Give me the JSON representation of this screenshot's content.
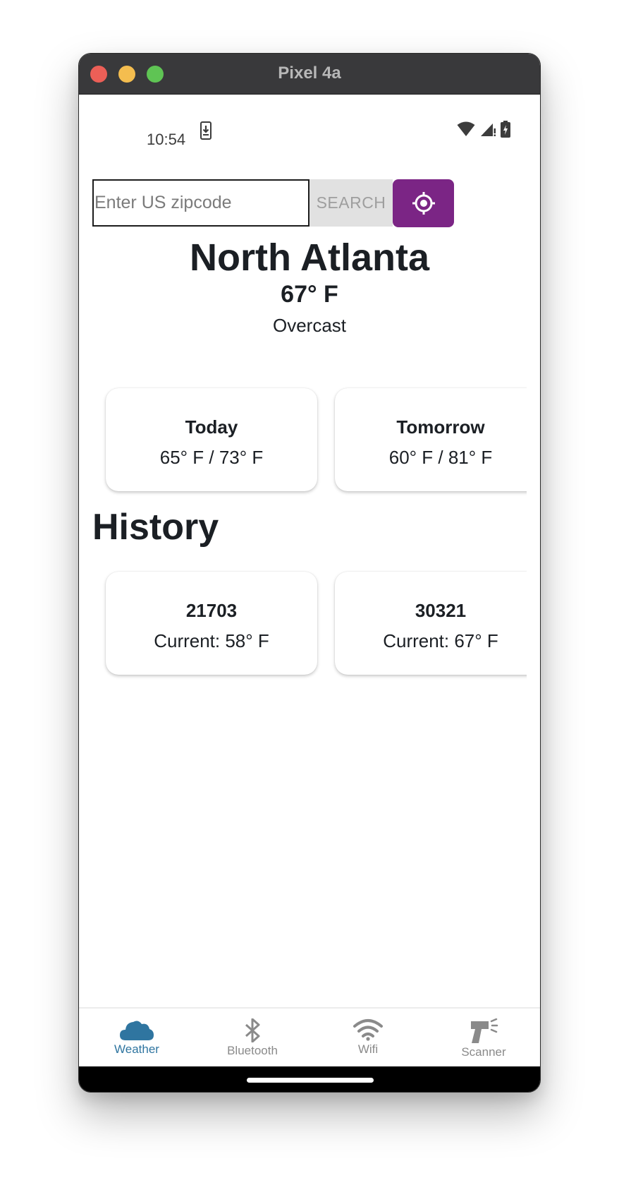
{
  "window": {
    "title": "Pixel 4a"
  },
  "status_bar": {
    "time": "10:54",
    "icons": [
      "download-icon",
      "wifi-icon",
      "signal-icon",
      "battery-icon"
    ]
  },
  "search": {
    "placeholder": "Enter US zipcode",
    "value": "",
    "button_label": "SEARCH",
    "locate_icon": "gps-locate-icon"
  },
  "current": {
    "city": "North Atlanta",
    "temperature": "67° F",
    "condition": "Overcast"
  },
  "forecast": [
    {
      "day": "Today",
      "range": "65° F / 73° F"
    },
    {
      "day": "Tomorrow",
      "range": "60° F / 81° F"
    }
  ],
  "history": {
    "heading": "History",
    "items": [
      {
        "zip": "21703",
        "current": "Current: 58° F"
      },
      {
        "zip": "30321",
        "current": "Current: 67° F"
      }
    ]
  },
  "tabs": [
    {
      "label": "Weather",
      "icon": "cloud-icon",
      "active": true
    },
    {
      "label": "Bluetooth",
      "icon": "bluetooth-icon",
      "active": false
    },
    {
      "label": "Wifi",
      "icon": "wifi-icon",
      "active": false
    },
    {
      "label": "Scanner",
      "icon": "scanner-icon",
      "active": false
    }
  ],
  "colors": {
    "accent": "#7b2585",
    "active_tab": "#2f75a0",
    "inactive_tab": "#8a8a8a",
    "text": "#1b1f24"
  }
}
